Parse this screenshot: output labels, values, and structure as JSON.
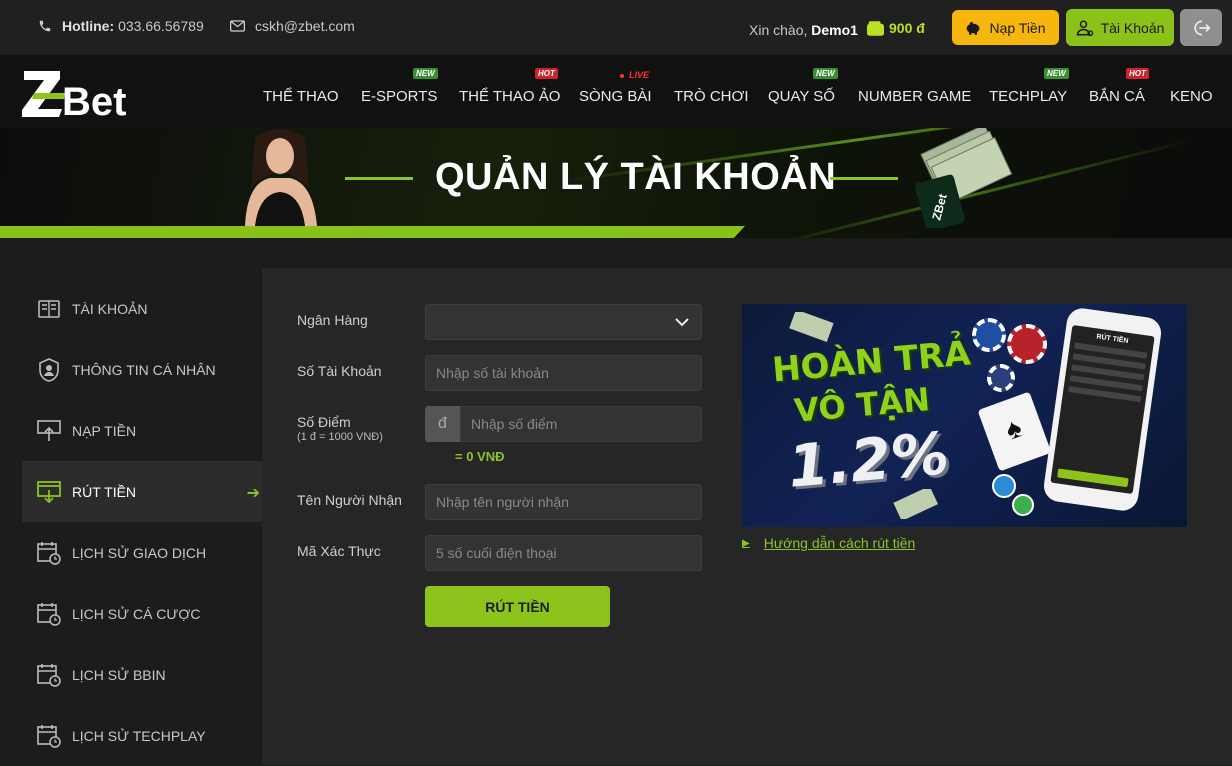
{
  "topbar": {
    "hotline_label": "Hotline:",
    "hotline_number": "033.66.56789",
    "email": "cskh@zbet.com",
    "greeting": "Xin chào,",
    "username": "Demo1",
    "balance": "900 đ",
    "deposit_label": "Nạp Tiền",
    "account_label": "Tài Khoản"
  },
  "logo_text": "ZBet",
  "nav": [
    {
      "label": "THỂ THAO",
      "badge": ""
    },
    {
      "label": "E-SPORTS",
      "badge": "NEW"
    },
    {
      "label": "THỂ THAO ẢO",
      "badge": "HOT"
    },
    {
      "label": "SÒNG BÀI",
      "badge": "LIVE"
    },
    {
      "label": "TRÒ CHƠI",
      "badge": ""
    },
    {
      "label": "QUAY SỐ",
      "badge": "NEW"
    },
    {
      "label": "NUMBER GAME",
      "badge": ""
    },
    {
      "label": "TECHPLAY",
      "badge": "NEW"
    },
    {
      "label": "BẮN CÁ",
      "badge": "HOT"
    },
    {
      "label": "KENO",
      "badge": ""
    }
  ],
  "banner": {
    "title": "QUẢN LÝ TÀI KHOẢN",
    "logo_text": "ZBet"
  },
  "sidebar": {
    "items": [
      {
        "label": "TÀI KHOẢN",
        "icon": "account-book-icon"
      },
      {
        "label": "THÔNG TIN CÁ NHÂN",
        "icon": "personal-info-icon"
      },
      {
        "label": "NẠP TIỀN",
        "icon": "deposit-icon"
      },
      {
        "label": "RÚT TIỀN",
        "icon": "withdraw-icon",
        "active": true
      },
      {
        "label": "LỊCH SỬ GIAO DỊCH",
        "icon": "calendar-history-icon"
      },
      {
        "label": "LỊCH SỬ CÁ CƯỢC",
        "icon": "calendar-history-icon"
      },
      {
        "label": "LỊCH SỬ BBIN",
        "icon": "calendar-history-icon"
      },
      {
        "label": "LỊCH SỬ TECHPLAY",
        "icon": "calendar-history-icon"
      }
    ]
  },
  "form": {
    "bank_label": "Ngân Hàng",
    "bank_value": "",
    "account_number_label": "Số Tài Khoản",
    "account_number_placeholder": "Nhập số tài khoản",
    "points_label": "Số Điểm",
    "points_note": "(1 đ = 1000 VNĐ)",
    "points_prefix": "đ",
    "points_placeholder": "Nhập số điểm",
    "conversion": "= 0 VNĐ",
    "recipient_label": "Tên Người Nhận",
    "recipient_placeholder": "Nhập tên người nhận",
    "verify_label": "Mã Xác Thực",
    "verify_placeholder": "5 số cuối điện thoại",
    "submit_label": "RÚT TIỀN"
  },
  "promo": {
    "line1": "HOÀN TRẢ",
    "line2": "VÔ TẬN",
    "rate": "1.2%",
    "phone_title": "RÚT TIỀN",
    "guide_link": "Hướng dẫn cách rút tiền"
  },
  "colors": {
    "accent_green": "#8cc41c",
    "deposit_yellow": "#f6b60d",
    "hot_red": "#c9252b",
    "new_green": "#3a8f2f"
  }
}
